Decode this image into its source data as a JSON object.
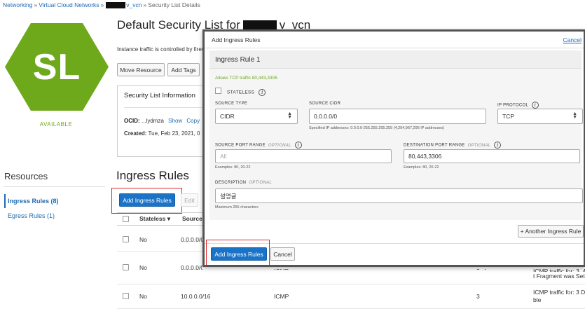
{
  "breadcrumb": {
    "networking": "Networking",
    "sep": "»",
    "vcns": "Virtual Cloud Networks",
    "vcn_suffix": "v_vcn",
    "current": "Security List Details"
  },
  "resource": {
    "initials": "SL",
    "status": "AVAILABLE",
    "title_prefix": "Default Security List for",
    "title_suffix": "v_vcn",
    "intro_text": "Instance traffic is controlled by firewall rules"
  },
  "actions": {
    "move": "Move Resource",
    "tags": "Add Tags"
  },
  "info_card": {
    "title": "Security List Information",
    "ocid_label": "OCID:",
    "ocid_value": "...lydmza",
    "show": "Show",
    "copy": "Copy",
    "created_label": "Created:",
    "created_value": "Tue, Feb 23, 2021, 0"
  },
  "sidebar": {
    "resources_title": "Resources",
    "items": [
      {
        "label": "Ingress Rules (8)"
      },
      {
        "label": "Egress Rules (1)"
      }
    ]
  },
  "ingress": {
    "title": "Ingress Rules",
    "add_button": "Add Ingress Rules",
    "edit_button": "Edit",
    "columns": {
      "stateless": "Stateless ▾",
      "source": "Source"
    },
    "rows": [
      {
        "stateless": "No",
        "source": "0.0.0.0/0",
        "protocol": "",
        "type": "",
        "description": ""
      },
      {
        "stateless": "No",
        "source": "0.0.0.0/0",
        "protocol": "ICMP",
        "type": "3, 4",
        "description_line1": "ICMP traffic for: 3, 4 Destination Unreachable: Fragmentation Needed and Don't",
        "description_line2": "t Fragment was Set"
      },
      {
        "stateless": "No",
        "source": "10.0.0.0/16",
        "protocol": "ICMP",
        "type": "3",
        "description_line1": "ICMP traffic for: 3 Destination Unreachable",
        "description_line2": "ble"
      }
    ]
  },
  "modal": {
    "title": "Add Ingress Rules",
    "cancel_link": "Cancel",
    "rule_title": "Ingress Rule 1",
    "allows": "Allows TCP traffic 80,443,3306",
    "stateless_label": "STATELESS",
    "source_type_label": "SOURCE TYPE",
    "source_type_value": "CIDR",
    "source_cidr_label": "SOURCE CIDR",
    "source_cidr_value": "0.0.0.0/0",
    "source_cidr_hint": "Specified IP addresses: 0.0.0.0-255.255.255.255 (4,294,967,296 IP addresses)",
    "ip_protocol_label": "IP PROTOCOL",
    "ip_protocol_value": "TCP",
    "source_port_label": "SOURCE PORT RANGE",
    "optional": "OPTIONAL",
    "source_port_placeholder": "All",
    "source_port_hint": "Examples: 80, 20-22",
    "dest_port_label": "DESTINATION PORT RANGE",
    "dest_port_value": "80,443,3306",
    "dest_port_hint": "Examples: 80, 20-22",
    "description_label": "DESCRIPTION",
    "description_value": "설명글",
    "description_hint": "Maximum 255 characters",
    "another_button": "+ Another Ingress Rule",
    "add_button": "Add Ingress Rules",
    "cancel_button": "Cancel"
  },
  "colors": {
    "brand_green": "#6ea91c",
    "primary_blue": "#1a73c7",
    "highlight_red": "#e0262d"
  }
}
